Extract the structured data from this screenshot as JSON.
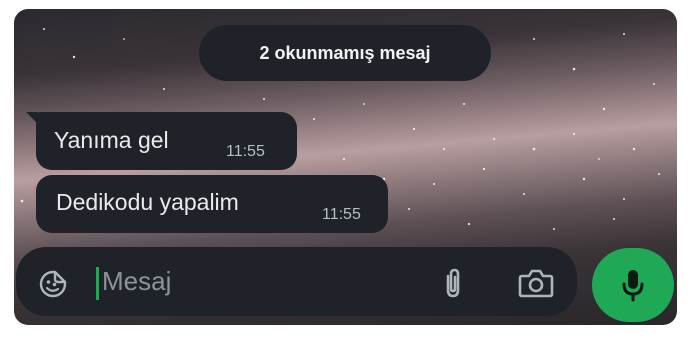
{
  "banner": {
    "unread_label": "2 okunmamış mesaj"
  },
  "messages": [
    {
      "text": "Yanıma gel",
      "time": "11:55"
    },
    {
      "text": "Dedikodu yapalim",
      "time": "11:55"
    }
  ],
  "composer": {
    "placeholder": "Mesaj"
  },
  "icons": {
    "sticker": "sticker-icon",
    "attach": "paperclip-icon",
    "camera": "camera-icon",
    "mic": "microphone-icon"
  },
  "colors": {
    "bubble": "#1f2329",
    "accent": "#1fa855",
    "time_text": "#b9bec4",
    "placeholder_text": "#8e9399"
  }
}
